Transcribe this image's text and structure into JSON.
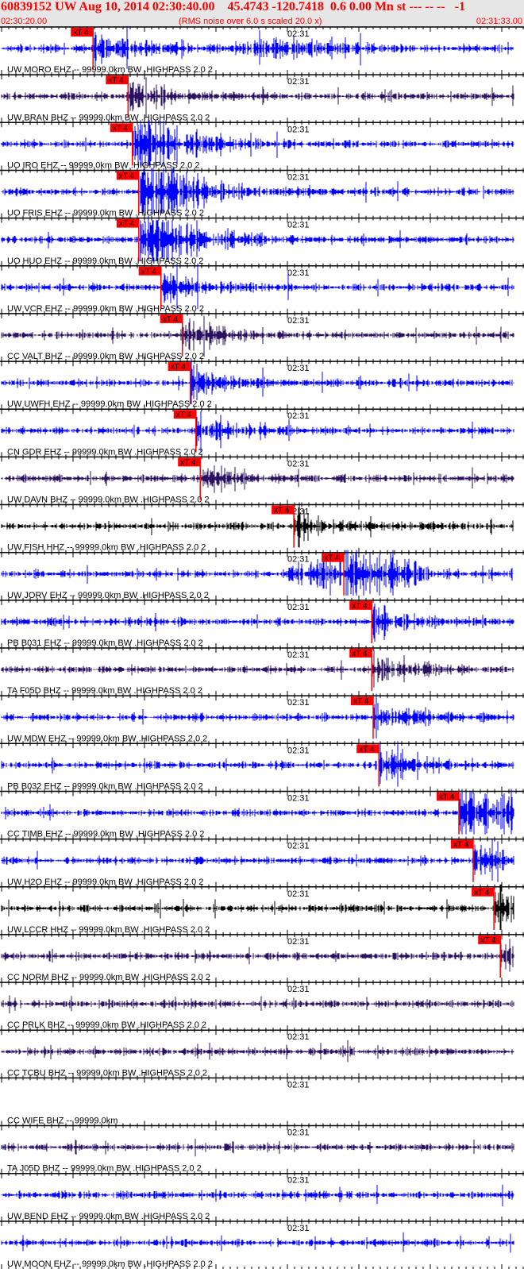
{
  "header": {
    "title": "60839152 UW Aug 10, 2014 02:30:40.00    45.4743 -120.7418  0.6 0.00 Mn st --- -- --   -1",
    "start_time": "02:30:20.00",
    "note": "(RMS noise over 6.0 s scaled 20.0 x)",
    "end_time": "02:31:33.00"
  },
  "minute_label": "02:31",
  "pick_label": "xT 4",
  "colors": {
    "blue": "#0000ff",
    "purple": "#2a1060",
    "black": "#000000",
    "red": "#ff0000"
  },
  "chart_data": {
    "type": "line",
    "title": "Seismogram record section",
    "x_range_s": [
      0,
      73
    ],
    "seconds_per_tick": 1,
    "traces": [
      {
        "label": "UW MORO EHZ -- 99999.0km BW .HIGHPASS  2.0  2",
        "color": "blue",
        "pick_s": 12.8
      },
      {
        "label": "UW BRAN BHZ -- 99999.0km BW .HIGHPASS  2.0  2",
        "color": "purple",
        "pick_s": 17.7
      },
      {
        "label": "UO IRO EHZ -- 99999.0km BW .HIGHPASS  2.0  2",
        "color": "blue",
        "pick_s": 18.3
      },
      {
        "label": "UO FRIS EHZ -- 99999.0km BW .HIGHPASS  2.0  2",
        "color": "blue",
        "pick_s": 19.2
      },
      {
        "label": "UO HUO EHZ -- 99999.0km BW .HIGHPASS  2.0  2",
        "color": "blue",
        "pick_s": 19.2
      },
      {
        "label": "UW VCR EHZ -- 99999.0km BW .HIGHPASS  2.0  2",
        "color": "blue",
        "pick_s": 22.3
      },
      {
        "label": "CC VALT BHZ -- 99999.0km BW .HIGHPASS  2.0  2",
        "color": "purple",
        "pick_s": 25.3
      },
      {
        "label": "UW UWFH EHZ -- 99999.0km BW .HIGHPASS  2.0  2",
        "color": "blue",
        "pick_s": 26.4
      },
      {
        "label": "CN GDR EHZ -- 99999.0km BW .HIGHPASS  2.0  2",
        "color": "blue",
        "pick_s": 27.2
      },
      {
        "label": "UW DAVN BHZ -- 99999.0km BW .HIGHPASS  2.0  2",
        "color": "purple",
        "pick_s": 27.8
      },
      {
        "label": "UW FISH HHZ -- 99999.0km BW .HIGHPASS  2.0  2",
        "color": "black",
        "pick_s": 40.9
      },
      {
        "label": "UW JORV EHZ -- 99999.0km BW .HIGHPASS  2.0  2",
        "color": "blue",
        "pick_s": 47.9
      },
      {
        "label": "PB B031 EHZ -- 99999.0km BW .HIGHPASS  2.0  2",
        "color": "blue",
        "pick_s": 51.8
      },
      {
        "label": "TA F05D BHZ -- 99999.0km BW .HIGHPASS  2.0  2",
        "color": "purple",
        "pick_s": 51.8
      },
      {
        "label": "UW MDW EHZ -- 99999.0km BW .HIGHPASS  2.0  2",
        "color": "blue",
        "pick_s": 52.0
      },
      {
        "label": "PB B032 EHZ -- 99999.0km BW .HIGHPASS  2.0  2",
        "color": "blue",
        "pick_s": 52.8
      },
      {
        "label": "CC TIMB EHZ -- 99999.0km BW .HIGHPASS  2.0  2",
        "color": "blue",
        "pick_s": 64.0
      },
      {
        "label": "UW H2O EHZ -- 99999.0km BW .HIGHPASS  2.0  2",
        "color": "blue",
        "pick_s": 66.0
      },
      {
        "label": "UW LCCR HHZ -- 99999.0km BW .HIGHPASS  2.0  2",
        "color": "black",
        "pick_s": 68.9
      },
      {
        "label": "CC NORM BHZ -- 99999.0km BW .HIGHPASS  2.0  2",
        "color": "purple",
        "pick_s": 69.8
      },
      {
        "label": "CC PRLK BHZ -- 99999.0km BW .HIGHPASS  2.0  2",
        "color": "purple",
        "pick_s": null
      },
      {
        "label": "CC TCBU BHZ -- 99999.0km BW .HIGHPASS  2.0  2",
        "color": "purple",
        "pick_s": null
      },
      {
        "label": "CC WIFE BHZ -- 99999.0km",
        "color": null,
        "pick_s": null
      },
      {
        "label": "TA J05D BHZ -- 99999.0km BW .HIGHPASS  2.0  2",
        "color": "purple",
        "pick_s": null
      },
      {
        "label": "UW BEND EHZ -- 99999.0km BW .HIGHPASS  2.0  2",
        "color": "blue",
        "pick_s": null
      },
      {
        "label": "UW MOON EHZ -- 99999.0km BW .HIGHPASS  2.0  2",
        "color": "blue",
        "pick_s": null
      }
    ]
  }
}
